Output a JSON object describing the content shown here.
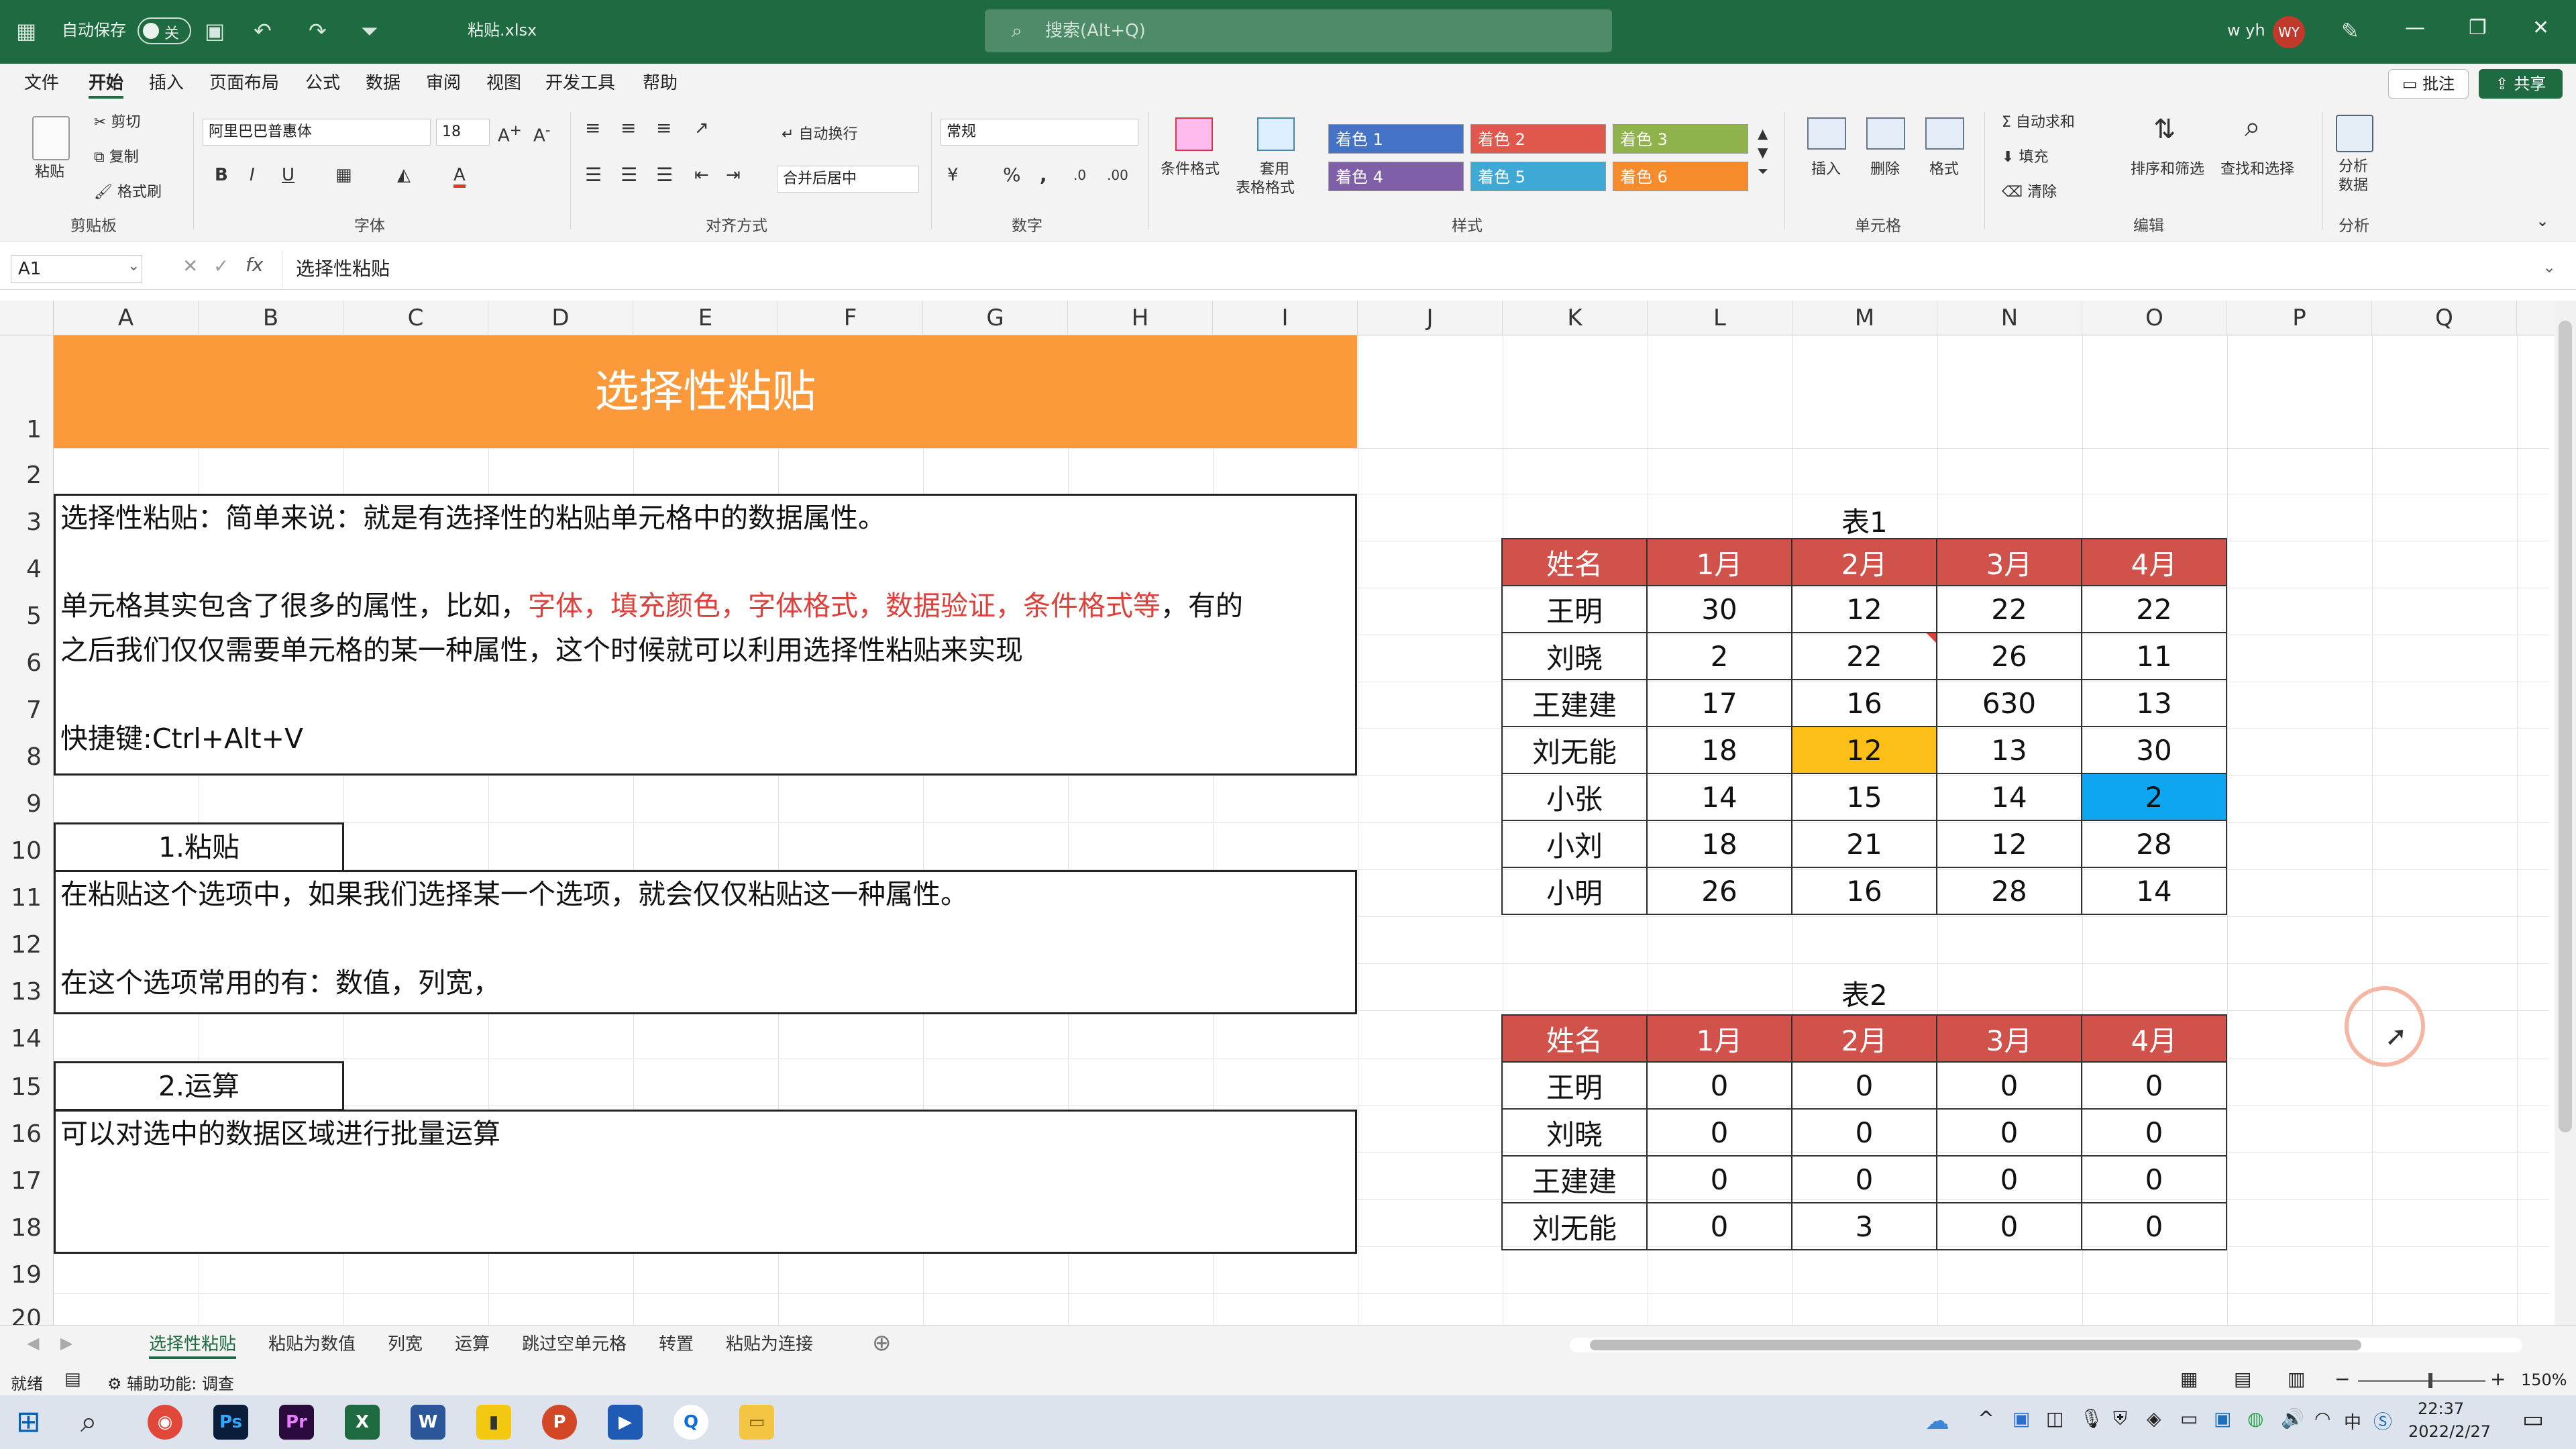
{
  "titlebar": {
    "autosave_label": "自动保存",
    "autosave_state": "关",
    "filename": "粘贴.xlsx",
    "search_placeholder": "搜索(Alt+Q)",
    "user_name": "w yh",
    "user_initials": "WY"
  },
  "menu": [
    "文件",
    "开始",
    "插入",
    "页面布局",
    "公式",
    "数据",
    "审阅",
    "视图",
    "开发工具",
    "帮助"
  ],
  "menu_active": "开始",
  "menu_right": {
    "comments": "批注",
    "share": "共享"
  },
  "ribbon": {
    "clipboard": {
      "paste": "粘贴",
      "cut": "剪切",
      "copy": "复制",
      "format_painter": "格式刷",
      "group": "剪贴板"
    },
    "font": {
      "name": "阿里巴巴普惠体",
      "size": "18",
      "group": "字体"
    },
    "alignment": {
      "wrap": "自动换行",
      "merge": "合并后居中",
      "group": "对齐方式"
    },
    "number": {
      "format": "常规",
      "group": "数字"
    },
    "styles": {
      "conditional": "条件格式",
      "table_format_1": "套用",
      "table_format_2": "表格格式",
      "swatches": [
        "着色 1",
        "着色 2",
        "着色 3",
        "着色 4",
        "着色 5",
        "着色 6"
      ],
      "swatch_colors": [
        "#4472c4",
        "#e0574b",
        "#8fb24a",
        "#7f5fa8",
        "#3fa9d6",
        "#f58b2b"
      ],
      "group": "样式"
    },
    "cells": {
      "insert": "插入",
      "delete": "删除",
      "format": "格式",
      "group": "单元格"
    },
    "editing": {
      "autosum": "自动求和",
      "fill": "填充",
      "clear": "清除",
      "sort": "排序和筛选",
      "find": "查找和选择",
      "group": "编辑"
    },
    "analysis": {
      "analyze_1": "分析",
      "analyze_2": "数据",
      "group": "分析"
    }
  },
  "formula": {
    "name_box": "A1",
    "fx": "fx",
    "content": "选择性粘贴"
  },
  "columns": [
    "A",
    "B",
    "C",
    "D",
    "E",
    "F",
    "G",
    "H",
    "I",
    "J",
    "K",
    "L",
    "M",
    "N",
    "O",
    "P",
    "Q"
  ],
  "rows": [
    "1",
    "2",
    "3",
    "4",
    "5",
    "6",
    "7",
    "8",
    "9",
    "10",
    "11",
    "12",
    "13",
    "14",
    "15",
    "16",
    "17",
    "18",
    "19",
    "20"
  ],
  "sheet": {
    "banner": "选择性粘贴",
    "intro": "选择性粘贴：简单来说：就是有选择性的粘贴单元格中的数据属性。",
    "para1_a": "单元格其实包含了很多的属性，比如，",
    "para1_red": "字体，填充颜色，字体格式，数据验证，条件格式等",
    "para1_b": "，有的",
    "para1_c": "之后我们仅仅需要单元格的某一种属性，这个时候就可以利用选择性粘贴来实现",
    "shortcut": "快捷键:Ctrl+Alt+V",
    "sec1_title": "1.粘贴",
    "sec1_line1": "在粘贴这个选项中，如果我们选择某一个选项，就会仅仅粘贴这一种属性。",
    "sec1_line2": "在这个选项常用的有：数值，列宽，",
    "sec2_title": "2.运算",
    "sec2_line1": "可以对选中的数据区域进行批量运算"
  },
  "table1": {
    "title": "表1",
    "headers": [
      "姓名",
      "1月",
      "2月",
      "3月",
      "4月"
    ],
    "rows": [
      [
        "王明",
        "30",
        "12",
        "22",
        "22"
      ],
      [
        "刘晓",
        "2",
        "22",
        "26",
        "11"
      ],
      [
        "王建建",
        "17",
        "16",
        "630",
        "13"
      ],
      [
        "刘无能",
        "18",
        "12",
        "13",
        "30"
      ],
      [
        "小张",
        "14",
        "15",
        "14",
        "2"
      ],
      [
        "小刘",
        "18",
        "21",
        "12",
        "28"
      ],
      [
        "小明",
        "26",
        "16",
        "28",
        "14"
      ]
    ],
    "highlight_colors": {
      "orange": "#fcbf17",
      "blue": "#0ea5f1"
    }
  },
  "table2": {
    "title": "表2",
    "headers": [
      "姓名",
      "1月",
      "2月",
      "3月",
      "4月"
    ],
    "rows": [
      [
        "王明",
        "0",
        "0",
        "0",
        "0"
      ],
      [
        "刘晓",
        "0",
        "0",
        "0",
        "0"
      ],
      [
        "王建建",
        "0",
        "0",
        "0",
        "0"
      ],
      [
        "刘无能",
        "0",
        "3",
        "0",
        "0"
      ]
    ]
  },
  "sheet_tabs": [
    "选择性粘贴",
    "粘贴为数值",
    "列宽",
    "运算",
    "跳过空单元格",
    "转置",
    "粘贴为连接"
  ],
  "sheet_tab_active": "选择性粘贴",
  "status": {
    "ready": "就绪",
    "accessibility": "辅助功能: 调查",
    "zoom": "150%"
  },
  "taskbar": {
    "time": "22:37",
    "date": "2022/2/27",
    "ime": "中"
  },
  "colors": {
    "excel_green": "#1e6b41",
    "banner_orange": "#fc9a3b",
    "header_red": "#d1514b",
    "text_red": "#e0403a"
  }
}
